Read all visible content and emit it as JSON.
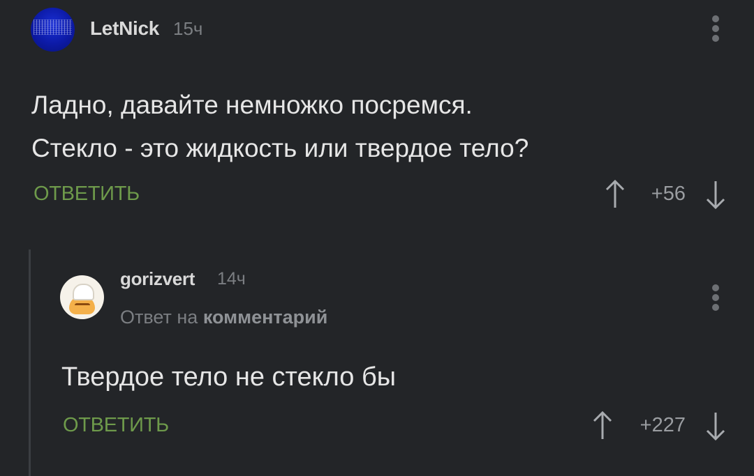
{
  "comments": [
    {
      "username": "LetNick",
      "time": "15ч",
      "text_lines": [
        "Ладно, давайте немножко посремся.",
        "Стекло - это жидкость или твердое тело?"
      ],
      "reply_label": "ОТВЕТИТЬ",
      "score": "+56",
      "avatar_icon": "avatar-blue-static-icon"
    },
    {
      "username": "gorizvert",
      "time": "14ч",
      "reply_to_prefix": "Ответ на",
      "reply_to_link": "комментарий",
      "text_lines": [
        "Твердое тело не стекло бы"
      ],
      "reply_label": "ОТВЕТИТЬ",
      "score": "+227",
      "avatar_icon": "avatar-chef-icon"
    }
  ],
  "icons": {
    "upvote": "arrow-up-icon",
    "downvote": "arrow-down-icon",
    "menu": "more-vertical-icon"
  },
  "colors": {
    "background": "#232528",
    "reply_action": "#6e9a4b",
    "muted_text": "#7b7e82",
    "body_text": "#e6e6e6"
  }
}
